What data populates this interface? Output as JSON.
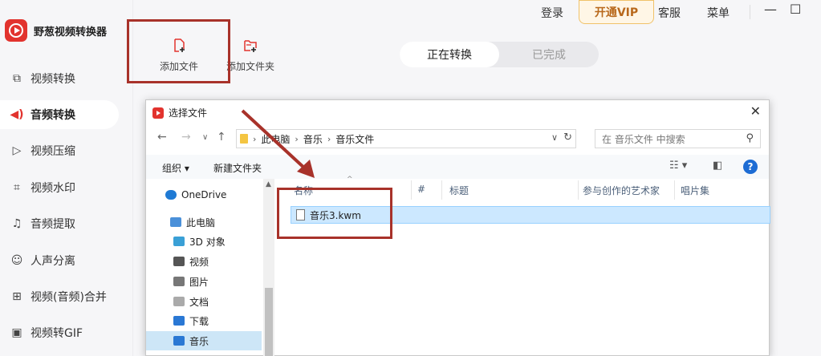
{
  "app": {
    "name": "野葱视频转换器"
  },
  "sidebar": {
    "items": [
      {
        "label": "视频转换",
        "icon": "video-convert-icon",
        "glyph": "⧉"
      },
      {
        "label": "音频转换",
        "icon": "audio-convert-icon",
        "glyph": "◀)",
        "active": true
      },
      {
        "label": "视频压缩",
        "icon": "video-compress-icon",
        "glyph": "▷"
      },
      {
        "label": "视频水印",
        "icon": "video-watermark-icon",
        "glyph": "⌗"
      },
      {
        "label": "音频提取",
        "icon": "audio-extract-icon",
        "glyph": "♫"
      },
      {
        "label": "人声分离",
        "icon": "vocal-separate-icon",
        "glyph": "☺"
      },
      {
        "label": "视频(音频)合并",
        "icon": "merge-icon",
        "glyph": "⊞"
      },
      {
        "label": "视频转GIF",
        "icon": "gif-icon",
        "glyph": "▣"
      }
    ]
  },
  "topbar": {
    "login": "登录",
    "vip": "开通VIP",
    "service": "客服",
    "menu": "菜单",
    "minimize": "—",
    "maximize": "☐"
  },
  "toolbar": {
    "add_file": "添加文件",
    "add_folder": "添加文件夹"
  },
  "tabs": {
    "converting": "正在转换",
    "done": "已完成"
  },
  "dialog": {
    "title": "选择文件",
    "close": "✕",
    "breadcrumb": [
      "此电脑",
      "音乐",
      "音乐文件"
    ],
    "search_placeholder": "在 音乐文件 中搜索",
    "organize": "组织 ▾",
    "new_folder": "新建文件夹",
    "tree": [
      {
        "label": "OneDrive",
        "icon": "cloud-icon"
      },
      {
        "label": "此电脑",
        "icon": "computer-icon"
      },
      {
        "label": "3D 对象",
        "icon": "3d-objects-icon"
      },
      {
        "label": "视频",
        "icon": "video-folder-icon"
      },
      {
        "label": "图片",
        "icon": "pictures-icon"
      },
      {
        "label": "文档",
        "icon": "documents-icon"
      },
      {
        "label": "下载",
        "icon": "download-icon"
      },
      {
        "label": "音乐",
        "icon": "music-icon",
        "selected": true
      }
    ],
    "columns": [
      "名称",
      "#",
      "标题",
      "参与创作的艺术家",
      "唱片集"
    ],
    "files": [
      {
        "name": "音乐3.kwm"
      }
    ]
  },
  "colors": {
    "accent": "#e2332e",
    "highlight": "#a8322a",
    "vip": "#b8681b"
  }
}
